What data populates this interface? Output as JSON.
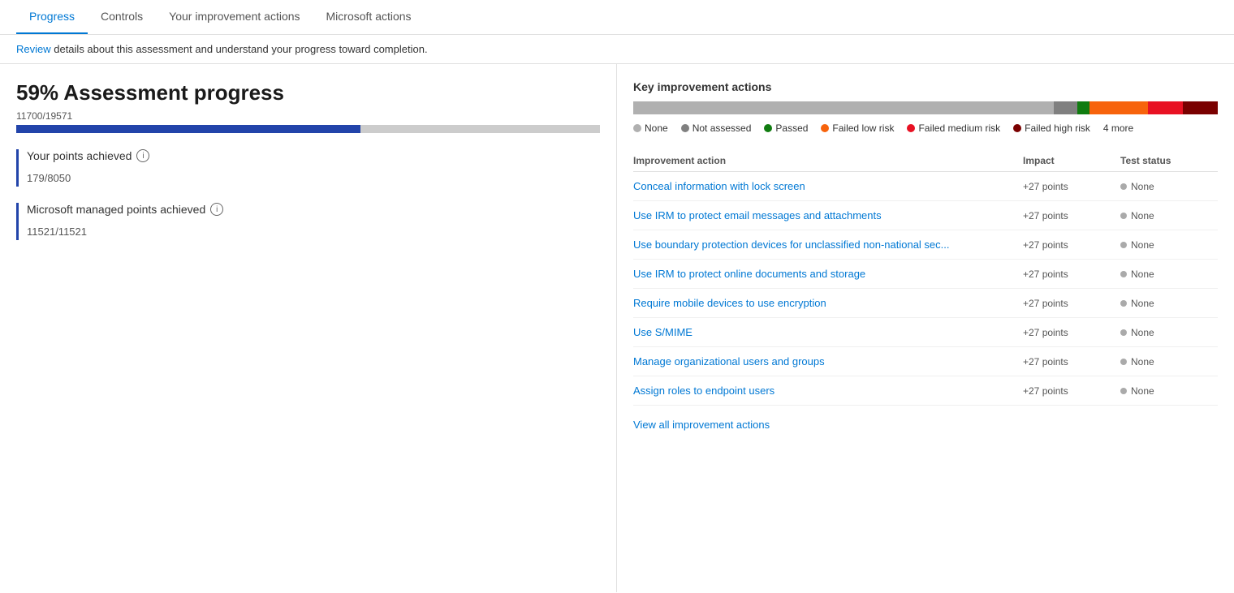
{
  "tabs": [
    {
      "id": "progress",
      "label": "Progress",
      "active": true
    },
    {
      "id": "controls",
      "label": "Controls",
      "active": false
    },
    {
      "id": "improvement-actions",
      "label": "Your improvement actions",
      "active": false
    },
    {
      "id": "microsoft-actions",
      "label": "Microsoft actions",
      "active": false
    }
  ],
  "subtitle": {
    "pre": "",
    "link": "Review",
    "post": " details about this assessment and understand your progress toward completion."
  },
  "left": {
    "assessment_label": "59% Assessment progress",
    "points_label": "11700/19571",
    "progress_pct": 59,
    "your_points": {
      "title": "Your points achieved",
      "value": "179",
      "total": "8050"
    },
    "ms_points": {
      "title": "Microsoft managed points achieved",
      "value": "11521",
      "total": "11521"
    }
  },
  "right": {
    "title": "Key improvement actions",
    "bar_segments": [
      {
        "color": "#b0b0b0",
        "pct": 72,
        "label": "None"
      },
      {
        "color": "#808080",
        "pct": 4,
        "label": "Not assessed"
      },
      {
        "color": "#107c10",
        "pct": 2,
        "label": "Passed"
      },
      {
        "color": "#f7630c",
        "pct": 10,
        "label": "Failed low risk"
      },
      {
        "color": "#e81123",
        "pct": 6,
        "label": "Failed medium risk"
      },
      {
        "color": "#7a0000",
        "pct": 6,
        "label": "Failed high risk"
      }
    ],
    "legend": [
      {
        "color": "#b0b0b0",
        "label": "None"
      },
      {
        "color": "#808080",
        "label": "Not assessed"
      },
      {
        "color": "#107c10",
        "label": "Passed"
      },
      {
        "color": "#f7630c",
        "label": "Failed low risk"
      },
      {
        "color": "#e81123",
        "label": "Failed medium risk"
      },
      {
        "color": "#7a0000",
        "label": "Failed high risk"
      },
      {
        "color": null,
        "label": "4 more"
      }
    ],
    "table_headers": [
      "Improvement action",
      "Impact",
      "Test status"
    ],
    "rows": [
      {
        "name": "Conceal information with lock screen",
        "impact": "+27 points",
        "status": "None"
      },
      {
        "name": "Use IRM to protect email messages and attachments",
        "impact": "+27 points",
        "status": "None"
      },
      {
        "name": "Use boundary protection devices for unclassified non-national sec...",
        "impact": "+27 points",
        "status": "None"
      },
      {
        "name": "Use IRM to protect online documents and storage",
        "impact": "+27 points",
        "status": "None"
      },
      {
        "name": "Require mobile devices to use encryption",
        "impact": "+27 points",
        "status": "None"
      },
      {
        "name": "Use S/MIME",
        "impact": "+27 points",
        "status": "None"
      },
      {
        "name": "Manage organizational users and groups",
        "impact": "+27 points",
        "status": "None"
      },
      {
        "name": "Assign roles to endpoint users",
        "impact": "+27 points",
        "status": "None"
      }
    ],
    "view_all_label": "View all improvement actions"
  }
}
